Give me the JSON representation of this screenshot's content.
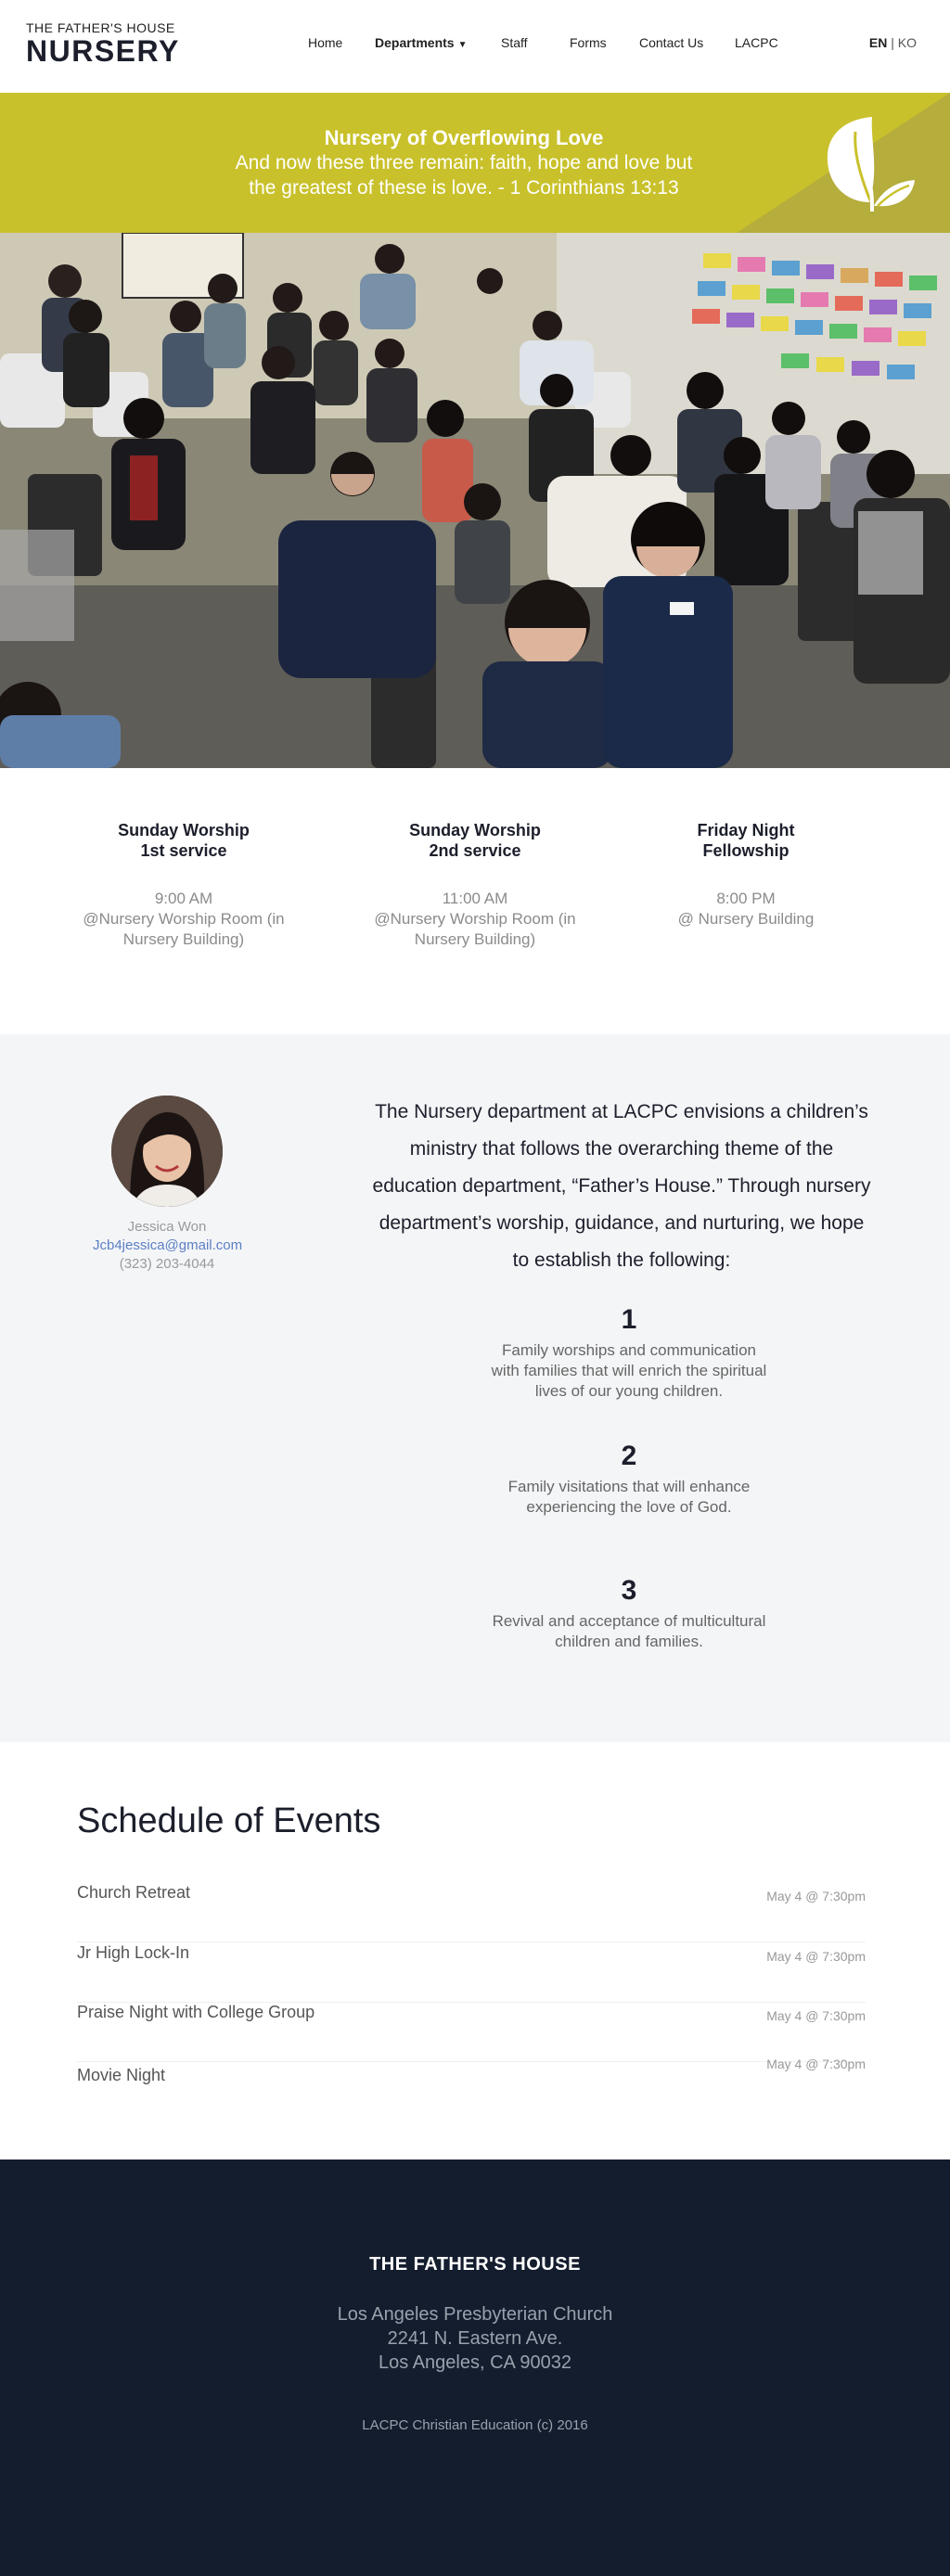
{
  "header": {
    "logo_small": "THE FATHER'S HOUSE",
    "logo_big": "NURSERY",
    "nav": [
      {
        "label": "Home"
      },
      {
        "label": "Departments"
      },
      {
        "label": "Staff"
      },
      {
        "label": "Forms"
      },
      {
        "label": "Contact Us"
      },
      {
        "label": "LACPC"
      }
    ],
    "lang_en": "EN",
    "lang_sep": "|",
    "lang_ko": "KO"
  },
  "banner": {
    "title": "Nursery of Overflowing Love",
    "verse_line1": "And now these three remain: faith, hope and love but",
    "verse_line2": "the greatest of these is love. - 1 Corinthians 13:13",
    "icon": "leaf-icon",
    "bg_color": "#c9c12b"
  },
  "services": [
    {
      "title_line1": "Sunday Worship",
      "title_line2": "1st service",
      "time": "9:00 AM",
      "loc_line1": "@Nursery Worship Room (in",
      "loc_line2": "Nursery Building)"
    },
    {
      "title_line1": "Sunday Worship",
      "title_line2": "2nd service",
      "time": "11:00 AM",
      "loc_line1": "@Nursery Worship Room (in",
      "loc_line2": "Nursery Building)"
    },
    {
      "title_line1": "Friday Night",
      "title_line2": "Fellowship",
      "time": "8:00 PM",
      "loc_line1": "@ Nursery Building",
      "loc_line2": ""
    }
  ],
  "contact": {
    "name": "Jessica Won",
    "email": "Jcb4jessica@gmail.com",
    "phone": "(323) 203-4044"
  },
  "vision": {
    "intro_lines": [
      "The Nursery department at LACPC envisions a children’s",
      "ministry that follows the overarching theme of the",
      "education department, “Father’s House.” Through nursery",
      "department’s worship, guidance, and nurturing, we hope",
      "to establish the following:"
    ],
    "points": [
      {
        "num": "1",
        "lines": [
          "Family worships and communication",
          "with families that will enrich the spiritual",
          "lives of our young children."
        ]
      },
      {
        "num": "2",
        "lines": [
          "Family visitations that will enhance",
          "experiencing the love of God."
        ]
      },
      {
        "num": "3",
        "lines": [
          "Revival and acceptance of multicultural",
          "children and families."
        ]
      }
    ]
  },
  "schedule": {
    "title": "Schedule of Events",
    "events": [
      {
        "name": "Church Retreat",
        "date": "May 4 @ 7:30pm"
      },
      {
        "name": "Jr High Lock-In",
        "date": "May 4 @ 7:30pm"
      },
      {
        "name": "Praise Night with College Group",
        "date": "May 4 @ 7:30pm"
      },
      {
        "name": "Movie Night",
        "date": "May 4 @ 7:30pm"
      }
    ]
  },
  "footer": {
    "title": "THE FATHER'S HOUSE",
    "address_line1": "Los Angeles Presbyterian Church",
    "address_line2": "2241 N. Eastern Ave.",
    "address_line3": "Los Angeles, CA 90032",
    "copyright": "LACPC Christian Education (c) 2016",
    "bg_color": "#141d2e"
  }
}
